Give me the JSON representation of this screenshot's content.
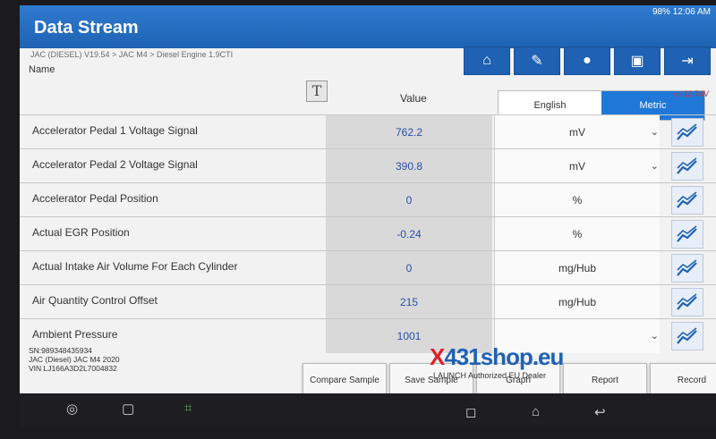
{
  "app": {
    "title": "Data Stream"
  },
  "status_bar": {
    "battery": "98%",
    "time": "12:06 AM"
  },
  "breadcrumb": "JAC (DIESEL) V19.54 > JAC M4 > Diesel Engine 1.9CTI",
  "toolbar": {
    "icons": [
      "home-icon",
      "edit-icon",
      "chat-icon",
      "print-icon",
      "exit-icon"
    ]
  },
  "table": {
    "name_header": "Name",
    "value_header": "Value",
    "unit_toggle": {
      "english": "English",
      "metric": "Metric",
      "selected": "Metric"
    },
    "battery_voltage": "12.74V",
    "rows": [
      {
        "name": "Accelerator Pedal 1 Voltage Signal",
        "value": "762.2",
        "unit": "mV",
        "has_dropdown": true
      },
      {
        "name": "Accelerator Pedal 2 Voltage Signal",
        "value": "390.8",
        "unit": "mV",
        "has_dropdown": true
      },
      {
        "name": "Accelerator Pedal Position",
        "value": "0",
        "unit": "%",
        "has_dropdown": false
      },
      {
        "name": "Actual EGR Position",
        "value": "-0.24",
        "unit": "%",
        "has_dropdown": false
      },
      {
        "name": "Actual Intake Air Volume For Each Cylinder",
        "value": "0",
        "unit": "mg/Hub",
        "has_dropdown": false
      },
      {
        "name": "Air Quantity Control Offset",
        "value": "215",
        "unit": "mg/Hub",
        "has_dropdown": false
      },
      {
        "name": "Ambient Pressure",
        "value": "1001",
        "unit": "",
        "has_dropdown": true
      }
    ]
  },
  "vehicle_info": {
    "sn": "SN:989348435934",
    "model": "JAC (Diesel) JAC M4 2020",
    "vin": "VIN LJ166A3D2L7004832"
  },
  "buttons": {
    "compare_sample": "Compare Sample",
    "save_sample": "Save Sample",
    "graph": "Graph",
    "report": "Report",
    "record": "Record"
  },
  "watermark": {
    "brand_x": "X",
    "brand_rest": "431shop.eu",
    "tagline": "LAUNCH Authorized EU Dealer"
  }
}
